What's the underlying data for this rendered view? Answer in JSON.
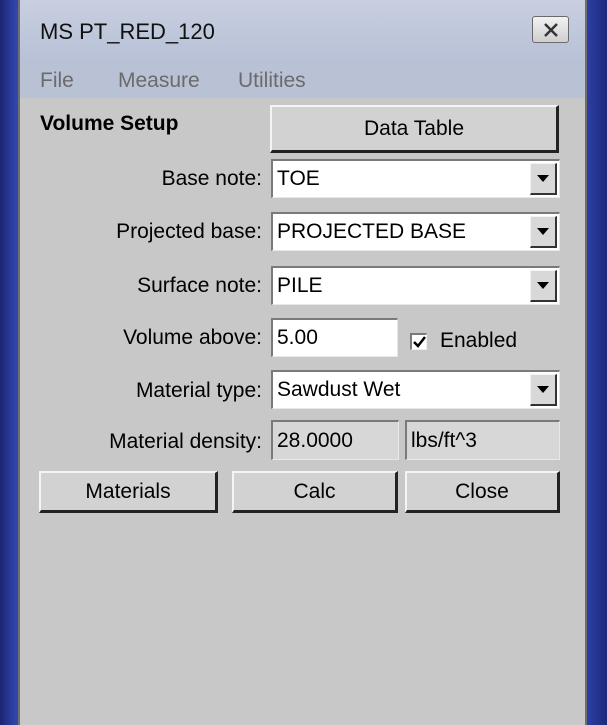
{
  "window": {
    "title": "MS PT_RED_120",
    "close_icon": "close-x-icon"
  },
  "menu": {
    "items": [
      "File",
      "Measure",
      "Utilities"
    ]
  },
  "volume_setup": {
    "section_title": "Volume Setup",
    "data_table_label": "Data Table",
    "base_note": {
      "label": "Base note:",
      "value": "TOE"
    },
    "projected_base": {
      "label": "Projected base:",
      "value": "PROJECTED BASE"
    },
    "surface_note": {
      "label": "Surface note:",
      "value": "PILE"
    },
    "volume_above": {
      "label": "Volume above:",
      "value": "5.00",
      "enabled_label": "Enabled",
      "enabled_checked": true
    },
    "material_type": {
      "label": "Material type:",
      "value": "Sawdust Wet"
    },
    "material_density": {
      "label": "Material density:",
      "value": "28.0000",
      "units": "lbs/ft^3"
    }
  },
  "buttons": {
    "materials": "Materials",
    "calc": "Calc",
    "close": "Close"
  }
}
